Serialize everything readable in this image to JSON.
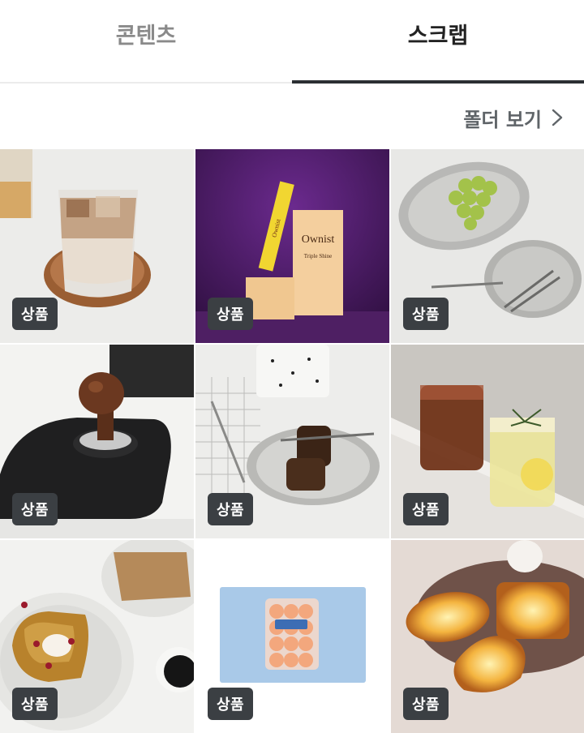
{
  "tabs": [
    {
      "label": "콘텐츠",
      "active": false
    },
    {
      "label": "스크랩",
      "active": true
    }
  ],
  "folder_link": {
    "label": "폴더 보기",
    "icon": "chevron-right-icon"
  },
  "items": [
    {
      "badge": "상품",
      "subject": "iced-latte-glass"
    },
    {
      "badge": "상품",
      "subject": "ownist-supplement-box",
      "brand_text": "Ownist",
      "sub_text": "Triple Shine",
      "stick_text": "Ownist"
    },
    {
      "badge": "상품",
      "subject": "grapes-on-steel-tray"
    },
    {
      "badge": "상품",
      "subject": "coffee-tamper-mat"
    },
    {
      "badge": "상품",
      "subject": "canele-on-plate"
    },
    {
      "badge": "상품",
      "subject": "iced-tea-glasses"
    },
    {
      "badge": "상품",
      "subject": "french-toast-plate"
    },
    {
      "badge": "상품",
      "subject": "peach-pack-on-blue-mat"
    },
    {
      "badge": "상품",
      "subject": "bread-lamps"
    }
  ],
  "colors": {
    "accent": "#2b2f33",
    "badge_bg": "#3b3f43",
    "inactive_tab": "#8a8a8a"
  }
}
